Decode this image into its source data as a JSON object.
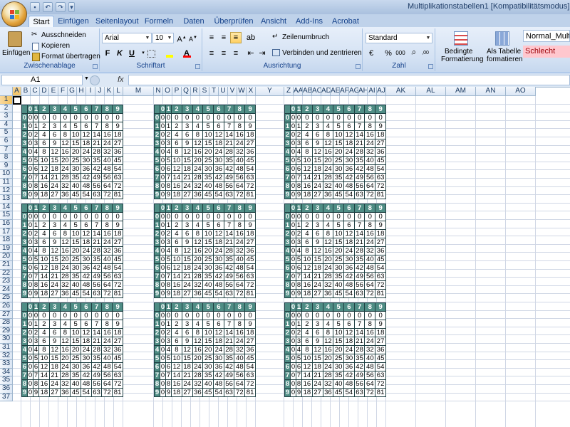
{
  "window": {
    "title": "Multiplikationstabellen1  [Kompatibilitätsmodus]  -  Micr"
  },
  "ribbon_tabs": [
    {
      "label": "Start",
      "active": true
    },
    {
      "label": "Einfügen"
    },
    {
      "label": "Seitenlayout"
    },
    {
      "label": "Formeln"
    },
    {
      "label": "Daten"
    },
    {
      "label": "Überprüfen"
    },
    {
      "label": "Ansicht"
    },
    {
      "label": "Add-Ins"
    },
    {
      "label": "Acrobat"
    }
  ],
  "ribbon": {
    "clipboard": {
      "label": "Zwischenablage",
      "paste": "Einfügen",
      "cut": "Ausschneiden",
      "copy": "Kopieren",
      "format_painter": "Format übertragen"
    },
    "font": {
      "label": "Schriftart",
      "font_name": "Arial",
      "font_size": "10"
    },
    "alignment": {
      "label": "Ausrichtung",
      "wrap": "Zeilenumbruch",
      "merge": "Verbinden und zentrieren"
    },
    "number": {
      "label": "Zahl",
      "format": "Standard"
    },
    "styles": {
      "conditional": "Bedingte",
      "conditional2": "Formatierung",
      "as_table": "Als Tabelle",
      "as_table2": "formatieren",
      "style1": "Normal_Multi...",
      "style2": "Schlecht"
    }
  },
  "formula_bar": {
    "name_box": "A1",
    "fx": "fx",
    "content": ""
  },
  "columns": [
    "A",
    "B",
    "C",
    "D",
    "E",
    "F",
    "G",
    "H",
    "I",
    "J",
    "K",
    "L",
    "M",
    "N",
    "O",
    "P",
    "Q",
    "R",
    "S",
    "T",
    "U",
    "V",
    "W",
    "X",
    "Y",
    "Z",
    "AA",
    "AB",
    "AC",
    "AD",
    "AE",
    "AF",
    "AG",
    "AH",
    "AI",
    "AJ",
    "AK",
    "AL",
    "AM",
    "AN",
    "AO"
  ],
  "rows": [
    "1",
    "2",
    "3",
    "4",
    "5",
    "6",
    "7",
    "8",
    "9",
    "10",
    "11",
    "12",
    "13",
    "14",
    "15",
    "16",
    "17",
    "18",
    "19",
    "20",
    "21",
    "22",
    "23",
    "24",
    "25",
    "26",
    "27",
    "28",
    "29",
    "30",
    "31",
    "32",
    "33",
    "34",
    "35",
    "36",
    "37"
  ],
  "table": {
    "header": [
      "0",
      "1",
      "2",
      "3",
      "4",
      "5",
      "6",
      "7",
      "8",
      "9"
    ],
    "rows": [
      [
        "0",
        "0",
        "0",
        "0",
        "0",
        "0",
        "0",
        "0",
        "0",
        "0"
      ],
      [
        "0",
        "1",
        "2",
        "3",
        "4",
        "5",
        "6",
        "7",
        "8",
        "9"
      ],
      [
        "0",
        "2",
        "4",
        "6",
        "8",
        "10",
        "12",
        "14",
        "16",
        "18"
      ],
      [
        "0",
        "3",
        "6",
        "9",
        "12",
        "15",
        "18",
        "21",
        "24",
        "27"
      ],
      [
        "0",
        "4",
        "8",
        "12",
        "16",
        "20",
        "24",
        "28",
        "32",
        "36"
      ],
      [
        "0",
        "5",
        "10",
        "15",
        "20",
        "25",
        "30",
        "35",
        "40",
        "45"
      ],
      [
        "0",
        "6",
        "12",
        "18",
        "24",
        "30",
        "36",
        "42",
        "48",
        "54"
      ],
      [
        "0",
        "7",
        "14",
        "21",
        "28",
        "35",
        "42",
        "49",
        "56",
        "63"
      ],
      [
        "0",
        "8",
        "16",
        "24",
        "32",
        "40",
        "48",
        "56",
        "64",
        "72"
      ],
      [
        "0",
        "9",
        "18",
        "27",
        "36",
        "45",
        "54",
        "63",
        "72",
        "81"
      ]
    ]
  },
  "colors": {
    "table_header": "#4f8d85",
    "selected_header": "#f1c15f",
    "ribbon_bg": "#d3e1f3"
  }
}
